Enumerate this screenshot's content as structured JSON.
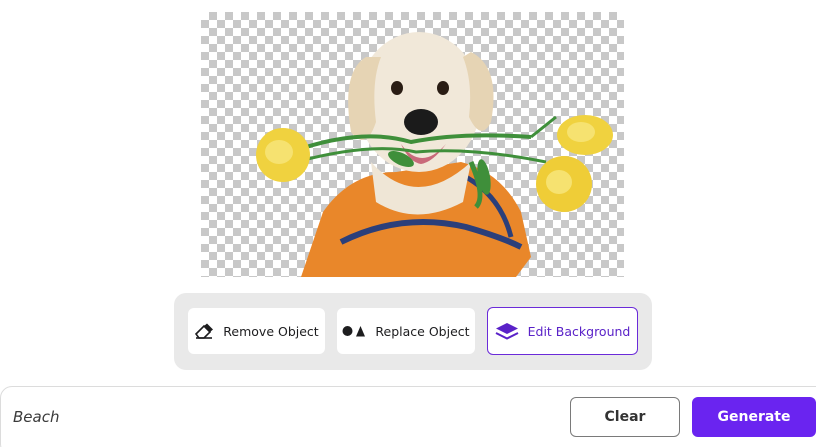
{
  "preview": {
    "subject": "puppy holding yellow roses, background removed",
    "icon": "dog-image"
  },
  "tools": [
    {
      "label": "Remove Object",
      "icon": "eraser-icon"
    },
    {
      "label": "Replace Object",
      "icon": "shapes-icon"
    },
    {
      "label": "Edit Background",
      "icon": "layers-icon",
      "selected": true
    }
  ],
  "prompt": {
    "value": "Beach",
    "clear_label": "Clear",
    "generate_label": "Generate"
  },
  "colors": {
    "accent": "#6a24f0",
    "selected_border": "#6b2bd9",
    "toolbar_bg": "#e9e9e9"
  }
}
